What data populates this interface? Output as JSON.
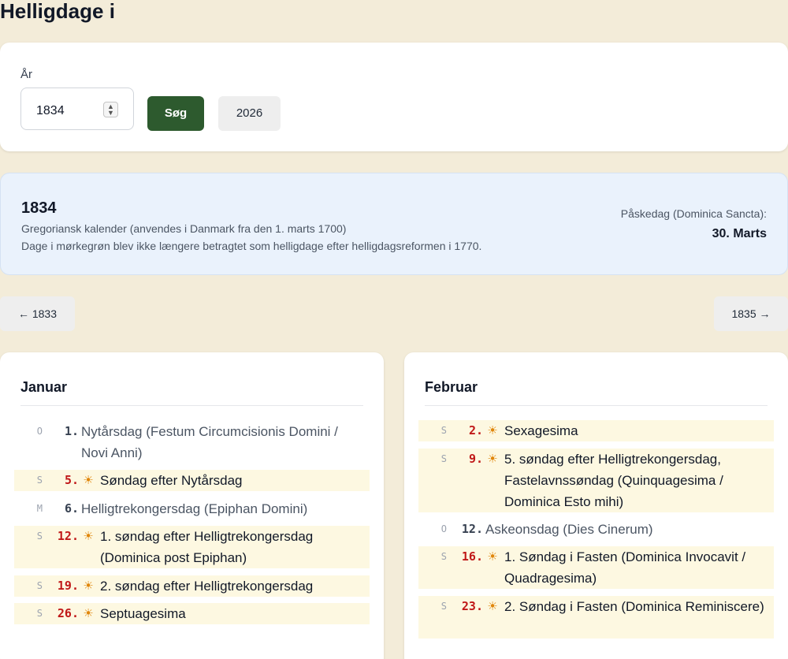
{
  "page": {
    "title": "Helligdage i"
  },
  "search": {
    "label": "År",
    "value": "1834",
    "submit_label": "Søg",
    "current_year_label": "2026"
  },
  "info": {
    "year": "1834",
    "calendar": "Gregoriansk kalender (anvendes i Danmark fra den 1. marts 1700)",
    "note": "Dage i mørkegrøn blev ikke længere betragtet som helligdage efter helligdagsreformen i 1770.",
    "easter_label": "Påskedag (Dominica Sancta):",
    "easter_date": "30. Marts"
  },
  "nav": {
    "prev": "← 1833",
    "next": "1835 →"
  },
  "colors": {
    "accent": "#2d5a2e",
    "sunday_number": "#c01818",
    "sun_icon": "#e0860b",
    "sunday_bg": "#fdf8e1"
  },
  "months": [
    {
      "name": "Januar",
      "days": [
        {
          "weekday": "O",
          "day": "1.",
          "name": "Nytårsdag (Festum Circumcisionis Domini / Novi Anni)",
          "sunday": false
        },
        {
          "weekday": "S",
          "day": "5.",
          "name": "Søndag efter Nytårsdag",
          "sunday": true
        },
        {
          "weekday": "M",
          "day": "6.",
          "name": "Helligtrekongersdag (Epiphan Domini)",
          "sunday": false
        },
        {
          "weekday": "S",
          "day": "12.",
          "name": "1. søndag efter Helligtrekongersdag (Dominica post Epiphan)",
          "sunday": true
        },
        {
          "weekday": "S",
          "day": "19.",
          "name": "2. søndag efter Helligtrekongersdag",
          "sunday": true
        },
        {
          "weekday": "S",
          "day": "26.",
          "name": "Septuagesima",
          "sunday": true
        }
      ]
    },
    {
      "name": "Februar",
      "days": [
        {
          "weekday": "S",
          "day": "2.",
          "name": "Sexagesima",
          "sunday": true
        },
        {
          "weekday": "S",
          "day": "9.",
          "name": "5. søndag efter Helligtrekongersdag, Fastelavnssøndag (Quinquagesima / Dominica Esto mihi)",
          "sunday": true
        },
        {
          "weekday": "O",
          "day": "12.",
          "name": "Askeonsdag (Dies Cinerum)",
          "sunday": false
        },
        {
          "weekday": "S",
          "day": "16.",
          "name": "1. Søndag i Fasten (Dominica Invocavit / Quadragesima)",
          "sunday": true
        },
        {
          "weekday": "S",
          "day": "23.",
          "name": "2. Søndag i Fasten (Dominica Reminiscere)",
          "sunday": true
        }
      ]
    }
  ],
  "icons": {
    "sunday": "sun-icon",
    "spinner": "spinner-icon"
  }
}
